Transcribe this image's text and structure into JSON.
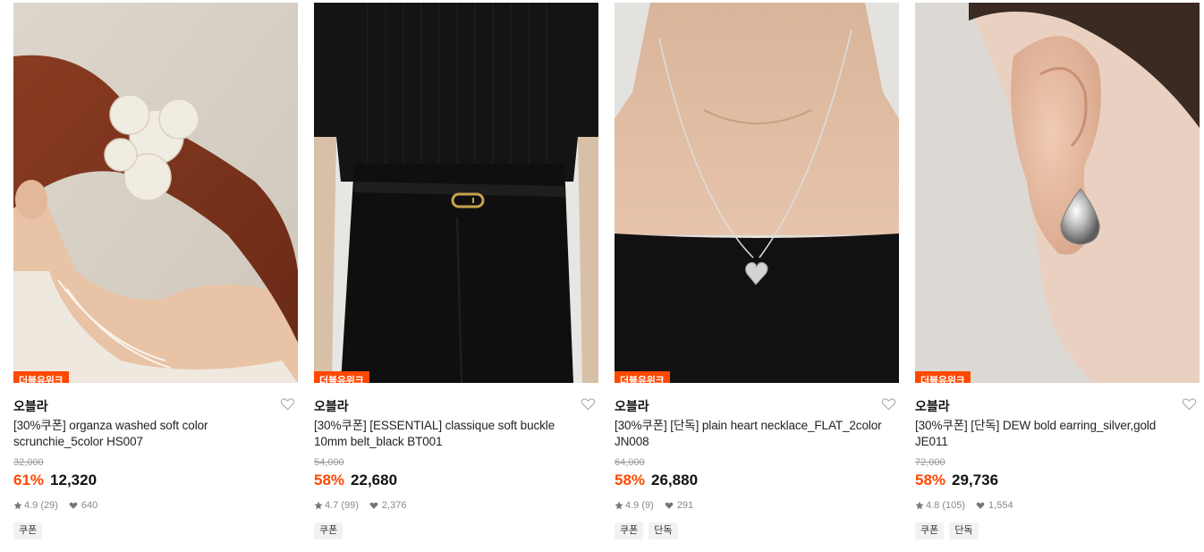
{
  "colors": {
    "accent": "#ff4800",
    "tag_bg": "#f2f2f2",
    "muted": "#888888"
  },
  "products": [
    {
      "image": "model back with white organza scrunchie",
      "badge": "더블유위크",
      "brand": "오블라",
      "title": "[30%쿠폰] organza washed soft color scrunchie_5color HS007",
      "original_price": "32,000",
      "discount": "61%",
      "price": "12,320",
      "rating": "4.9",
      "reviews": "(29)",
      "likes": "640",
      "tags": [
        "쿠폰"
      ]
    },
    {
      "image": "black ribbed top and skirt with thin black belt",
      "badge": "더블유위크",
      "brand": "오블라",
      "title": "[30%쿠폰] [ESSENTIAL] classique soft buckle 10mm belt_black BT001",
      "original_price": "54,000",
      "discount": "58%",
      "price": "22,680",
      "rating": "4.7",
      "reviews": "(99)",
      "likes": "2,376",
      "tags": [
        "쿠폰"
      ]
    },
    {
      "image": "silver heart pendant necklace on model",
      "badge": "더블유위크",
      "brand": "오블라",
      "title": "[30%쿠폰] [단독] plain heart necklace_FLAT_2color JN008",
      "original_price": "64,000",
      "discount": "58%",
      "price": "26,880",
      "rating": "4.9",
      "reviews": "(9)",
      "likes": "291",
      "tags": [
        "쿠폰",
        "단독"
      ]
    },
    {
      "image": "silver teardrop earring on ear",
      "badge": "더블유위크",
      "brand": "오블라",
      "title": "[30%쿠폰] [단독] DEW bold earring_silver,gold JE011",
      "original_price": "72,000",
      "discount": "58%",
      "price": "29,736",
      "rating": "4.8",
      "reviews": "(105)",
      "likes": "1,554",
      "tags": [
        "쿠폰",
        "단독"
      ]
    }
  ]
}
